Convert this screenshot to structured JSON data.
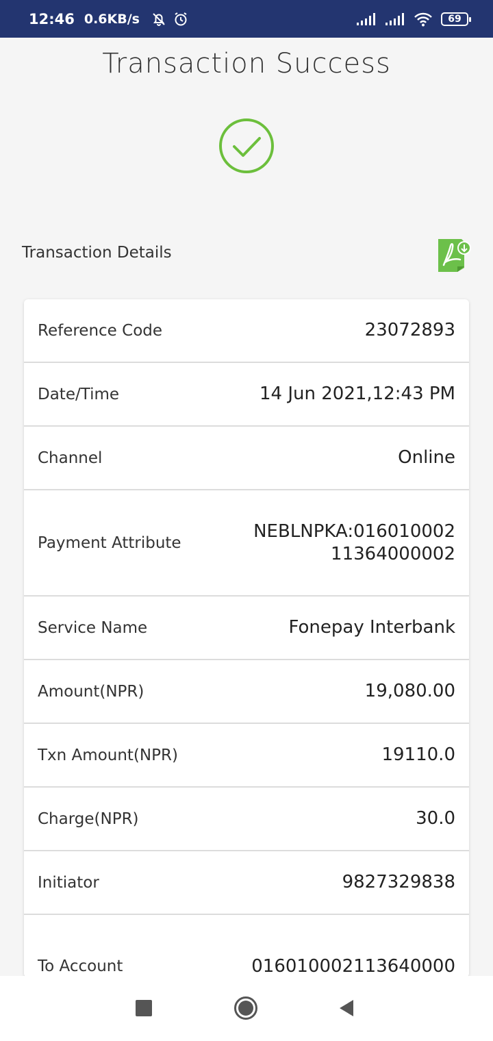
{
  "status_bar": {
    "time": "12:46",
    "speed": "0.6KB/s",
    "battery": "69",
    "icons": [
      "mute-bell-icon",
      "alarm-icon",
      "signal-icon",
      "signal-icon",
      "wifi-icon",
      "battery-icon"
    ]
  },
  "page": {
    "title": "Transaction Success"
  },
  "details": {
    "section_label": "Transaction Details",
    "rows": [
      {
        "label": "Reference Code",
        "value": "23072893"
      },
      {
        "label": "Date/Time",
        "value": "14 Jun 2021,12:43 PM"
      },
      {
        "label": "Channel",
        "value": "Online"
      },
      {
        "label": "Payment Attribute",
        "value": "NEBLNPKA:01601000211364000002"
      },
      {
        "label": "Service Name",
        "value": "Fonepay Interbank"
      },
      {
        "label": "Amount(NPR)",
        "value": "19,080.00"
      },
      {
        "label": "Txn Amount(NPR)",
        "value": "19110.0"
      },
      {
        "label": "Charge(NPR)",
        "value": "30.0"
      },
      {
        "label": "Initiator",
        "value": "9827329838"
      },
      {
        "label": "To Account",
        "value": "016010002113640000"
      }
    ]
  },
  "colors": {
    "status_bar": "#233570",
    "success_green": "#6cbf3c",
    "pdf_green": "#6cc04a"
  },
  "nav": {
    "icons": [
      "recents-square-icon",
      "home-circle-icon",
      "back-triangle-icon"
    ]
  }
}
